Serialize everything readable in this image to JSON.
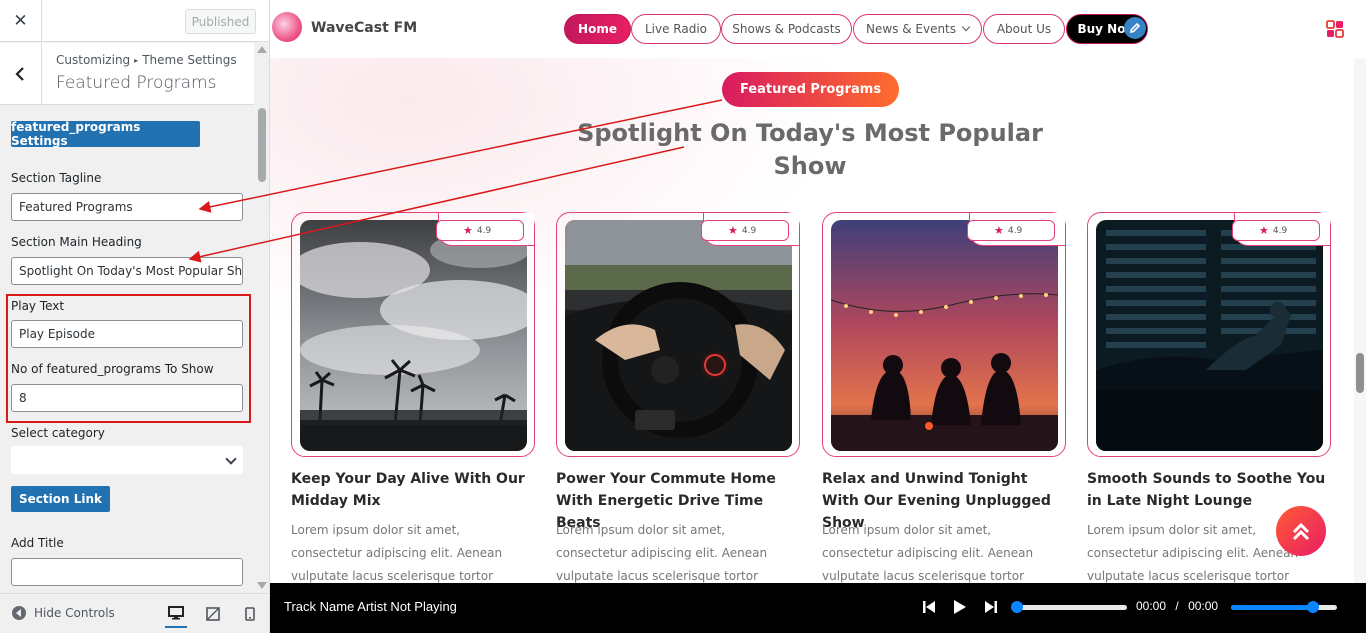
{
  "customizer": {
    "published_label": "Published",
    "breadcrumb_root": "Customizing",
    "breadcrumb_separator": "▸",
    "breadcrumb_parent": "Theme Settings",
    "title": "Featured Programs",
    "settings_button": "featured_programs Settings",
    "tagline_label": "Section Tagline",
    "tagline_value": "Featured Programs",
    "heading_label": "Section Main Heading",
    "heading_value": "Spotlight On Today's Most Popular Sho",
    "play_text_label": "Play Text",
    "play_text_value": "Play Episode",
    "count_label": "No of featured_programs To Show",
    "count_value": "8",
    "category_label": "Select category",
    "category_value": "",
    "section_link_button": "Section Link",
    "add_title_label": "Add Title",
    "add_title_value": "",
    "hide_controls": "Hide Controls"
  },
  "site": {
    "logo_text": "WaveCast FM",
    "nav": [
      "Home",
      "Live Radio",
      "Shows & Podcasts",
      "News & Events",
      "About Us",
      "Buy Now"
    ],
    "tagline": "Featured Programs",
    "heading": "Spotlight On Today's Most Popular Show",
    "cards": [
      {
        "rating": "4.9",
        "title": "Keep Your Day Alive With Our Midday Mix",
        "text": "Lorem ipsum dolor sit amet, consectetur adipiscing elit. Aenean vulputate lacus scelerisque tortor dignissim."
      },
      {
        "rating": "4.9",
        "title": "Power Your Commute Home With Energetic Drive Time Beats",
        "text": "Lorem ipsum dolor sit amet, consectetur adipiscing elit. Aenean vulputate lacus scelerisque tortor dignissim."
      },
      {
        "rating": "4.9",
        "title": "Relax and Unwind Tonight With Our Evening Unplugged Show",
        "text": "Lorem ipsum dolor sit amet, consectetur adipiscing elit. Aenean vulputate lacus scelerisque tortor dignissim."
      },
      {
        "rating": "4.9",
        "title": "Smooth Sounds to Soothe You in Late Night Lounge",
        "text": "Lorem ipsum dolor sit amet, consectetur adipiscing elit. Aenean vulputate lacus scelerisque tortor dignissim."
      }
    ]
  },
  "player": {
    "track": "Track Name Artist Not Playing",
    "current_time": "00:00",
    "time_separator": "/",
    "duration": "00:00",
    "volume_level": 0.82
  },
  "colors": {
    "accent": "#d81b60",
    "wp_blue": "#2271b1",
    "annotation_red": "#d91919"
  }
}
